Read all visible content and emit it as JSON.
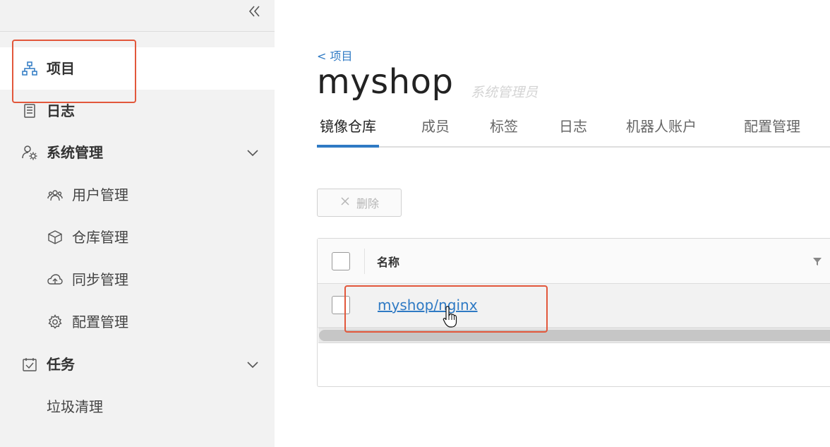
{
  "sidebar": {
    "collapse_icon": "double-chevron-left-icon",
    "items": [
      {
        "label": "项目",
        "icon": "projects-icon",
        "active": true
      },
      {
        "label": "日志",
        "icon": "log-icon"
      },
      {
        "label": "系统管理",
        "icon": "admin-gear-user-icon",
        "expandable": true
      },
      {
        "label": "用户管理",
        "icon": "users-icon",
        "sub": true
      },
      {
        "label": "仓库管理",
        "icon": "box-icon",
        "sub": true
      },
      {
        "label": "同步管理",
        "icon": "cloud-sync-icon",
        "sub": true
      },
      {
        "label": "配置管理",
        "icon": "gear-icon",
        "sub": true
      },
      {
        "label": "任务",
        "icon": "calendar-check-icon",
        "expandable": true
      },
      {
        "label": "垃圾清理",
        "sub": true
      }
    ]
  },
  "main": {
    "back_link": "< 项目",
    "title": "myshop",
    "role": "系统管理员",
    "tabs": [
      {
        "label": "镜像仓库",
        "active": true
      },
      {
        "label": "成员"
      },
      {
        "label": "标签"
      },
      {
        "label": "日志"
      },
      {
        "label": "机器人账户"
      },
      {
        "label": "配置管理"
      }
    ],
    "delete_button": {
      "label": "删除",
      "icon": "close-x-icon"
    },
    "table": {
      "columns": [
        "名称"
      ],
      "rows": [
        {
          "name": "myshop/nginx"
        }
      ]
    }
  },
  "colors": {
    "accent": "#2f7ac4",
    "annotation": "#e2573b",
    "sidebar_bg": "#f2f2f2"
  }
}
